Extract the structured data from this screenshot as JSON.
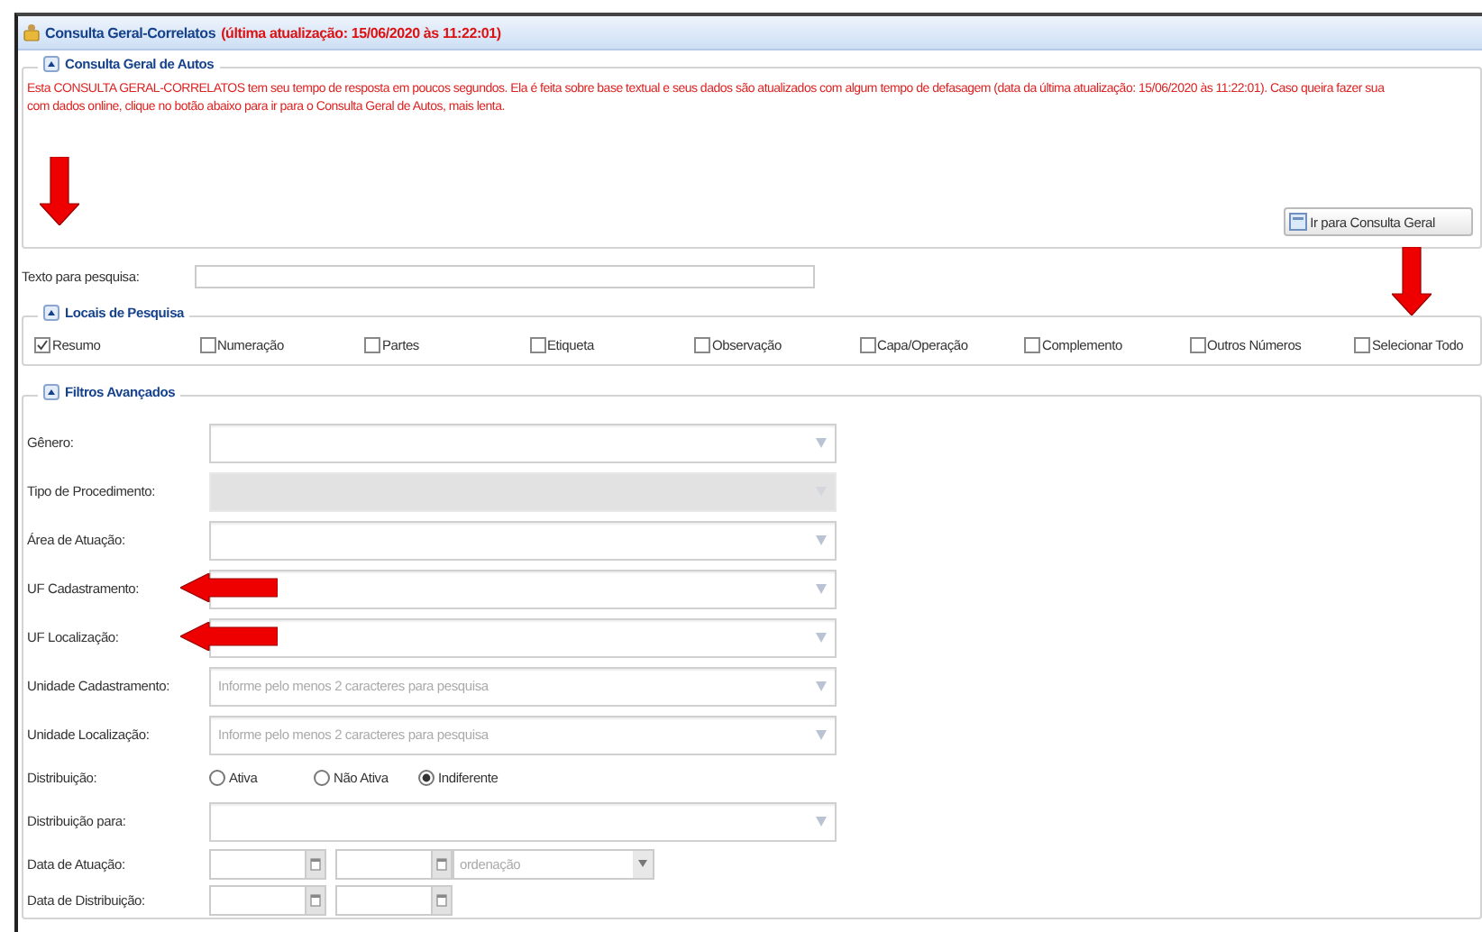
{
  "window": {
    "title": "Consulta Geral-Correlatos",
    "subtitle": "(última atualização: 15/06/2020 às 11:22:01)"
  },
  "autos_section": {
    "legend": "Consulta Geral de Autos",
    "description": [
      "Esta CONSULTA GERAL-CORRELATOS tem seu tempo de resposta em poucos segundos. Ela é feita sobre base textual e seus dados são atualizados com algum tempo de defasagem (data da última atualização: 15/06/2020 às 11:22:01). Caso queira fazer sua",
      "com dados online, clique no botão abaixo para ir para o Consulta Geral de Autos, mais lenta."
    ],
    "button": "Ir para Consulta Geral"
  },
  "search": {
    "label": "Texto para pesquisa:"
  },
  "locations": {
    "legend": "Locais de Pesquisa",
    "options": [
      {
        "label": "Resumo",
        "checked": true
      },
      {
        "label": "Numeração",
        "checked": false
      },
      {
        "label": "Partes",
        "checked": false
      },
      {
        "label": "Etiqueta",
        "checked": false
      },
      {
        "label": "Observação",
        "checked": false
      },
      {
        "label": "Capa/Operação",
        "checked": false
      },
      {
        "label": "Complemento",
        "checked": false
      },
      {
        "label": "Outros Números",
        "checked": false
      },
      {
        "label": "Selecionar Todo",
        "checked": false
      }
    ]
  },
  "filters": {
    "legend": "Filtros Avançados",
    "rows": [
      {
        "kind": "combo",
        "label": "Gênero:",
        "disabled": false
      },
      {
        "kind": "combo",
        "label": "Tipo de Procedimento:",
        "disabled": true
      },
      {
        "kind": "combo",
        "label": "Área de Atuação:",
        "disabled": false
      },
      {
        "kind": "combo",
        "label": "UF Cadastramento:",
        "disabled": false
      },
      {
        "kind": "combo",
        "label": "UF Localização:",
        "disabled": false
      },
      {
        "kind": "combo",
        "label": "Unidade Cadastramento:",
        "disabled": false,
        "placeholder": "Informe pelo menos 2 caracteres para pesquisa"
      },
      {
        "kind": "combo",
        "label": "Unidade Localização:",
        "disabled": false,
        "placeholder": "Informe pelo menos 2 caracteres para pesquisa"
      },
      {
        "kind": "radio",
        "label": "Distribuição:",
        "options": [
          {
            "label": "Ativa",
            "selected": false
          },
          {
            "label": "Não Ativa",
            "selected": false
          },
          {
            "label": "Indiferente",
            "selected": true
          }
        ]
      },
      {
        "kind": "combo",
        "label": "Distribuição para:",
        "disabled": false
      },
      {
        "kind": "dates",
        "label": "Data de Atuação:",
        "order_placeholder": "ordenação"
      },
      {
        "kind": "dates",
        "label": "Data de Distribuição:"
      }
    ]
  }
}
